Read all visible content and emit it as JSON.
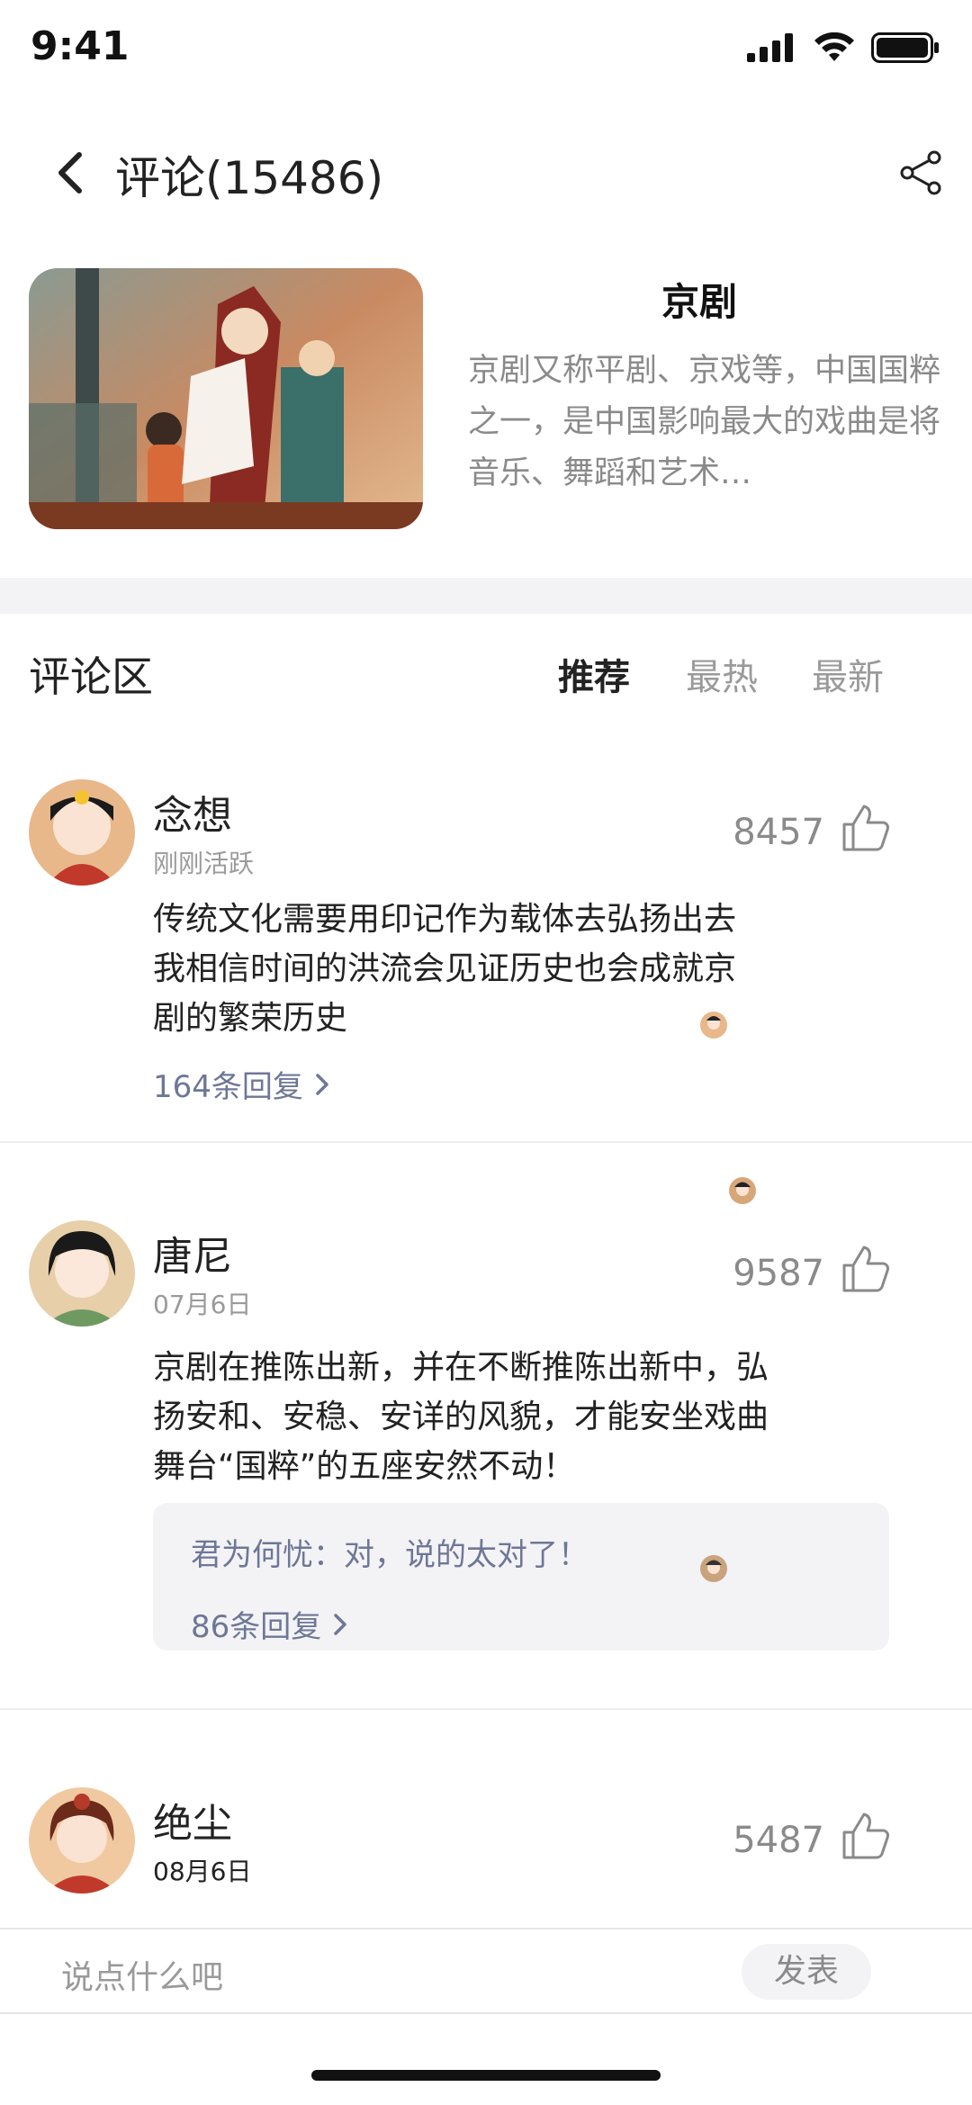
{
  "status_bar": {
    "time": "9:41"
  },
  "nav": {
    "title": "评论(15486)"
  },
  "topic": {
    "title": "京剧",
    "description": "京剧又称平剧、京戏等，中国国粹之一，是中国影响最大的戏曲是将音乐、舞蹈和艺术…"
  },
  "comments_section": {
    "heading": "评论区",
    "tabs": [
      {
        "label": "推荐",
        "active": true
      },
      {
        "label": "最热",
        "active": false
      },
      {
        "label": "最新",
        "active": false
      }
    ]
  },
  "comments": [
    {
      "name": "念想",
      "time": "刚刚活跃",
      "likes": "8457",
      "text_lines": [
        "传统文化需要用印记作为载体去弘扬出去",
        "我相信时间的洪流会见证历史也会成就京",
        "剧的繁荣历史"
      ],
      "replies": "164条回复"
    },
    {
      "name": "唐尼",
      "time": "07月6日",
      "likes": "9587",
      "text_lines": [
        "京剧在推陈出新，并在不断推陈出新中，弘",
        "扬安和、安稳、安详的风貌，才能安坐戏曲",
        "舞台“国粹”的五座安然不动！"
      ],
      "reply_preview": "君为何忧：对，说的太对了！",
      "replies": "86条回复"
    },
    {
      "name": "绝尘",
      "time": "08月6日",
      "likes": "5487"
    }
  ],
  "input_bar": {
    "placeholder": "说点什么吧",
    "post_label": "发表"
  },
  "colors": {
    "accent_text": "#6f7797",
    "muted": "#9a9a9a",
    "band": "#f3f3f5"
  },
  "icons": [
    "back-icon",
    "share-icon",
    "thumb-up-icon",
    "chevron-right-icon",
    "signal-icon",
    "wifi-icon",
    "battery-icon"
  ]
}
